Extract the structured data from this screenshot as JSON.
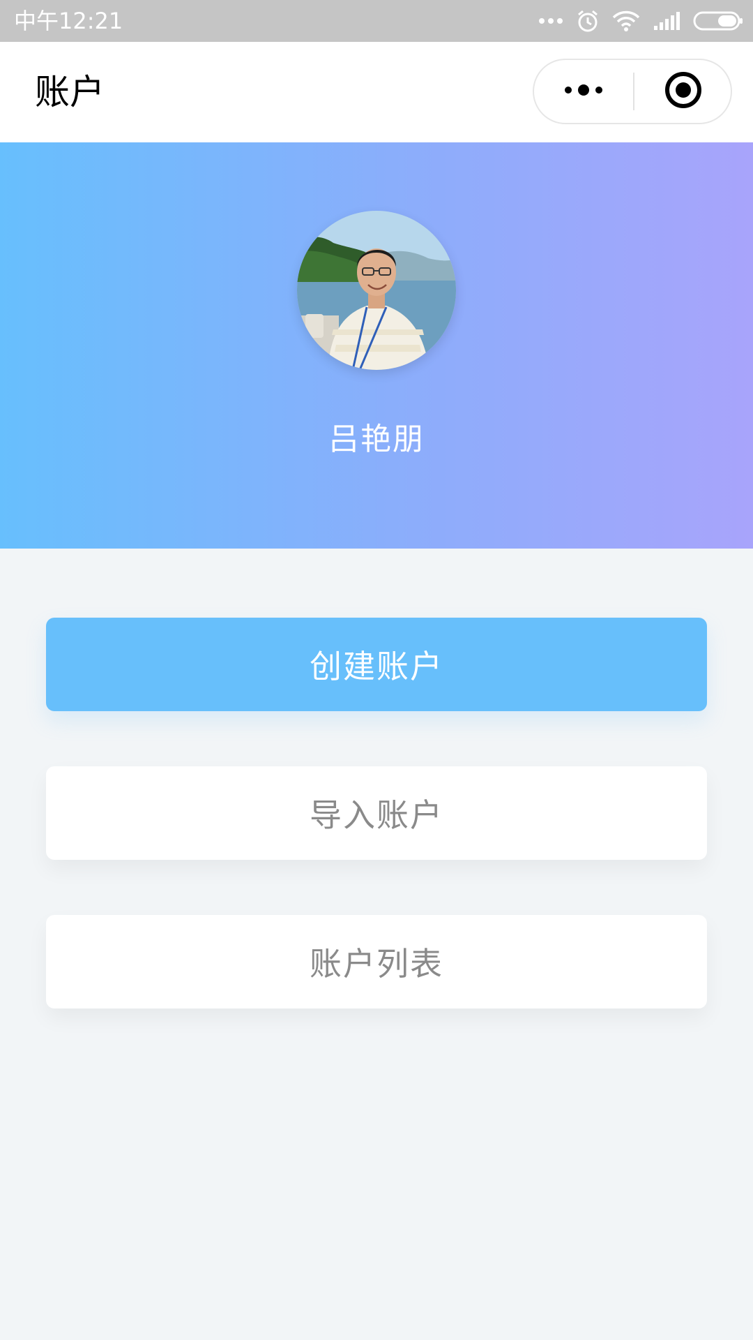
{
  "status_bar": {
    "time": "中午12:21",
    "icons": [
      "more-dots-icon",
      "alarm-icon",
      "wifi-icon",
      "signal-icon",
      "battery-icon"
    ]
  },
  "nav": {
    "title": "账户",
    "capsule_icons": [
      "more-icon",
      "close-miniprogram-icon"
    ]
  },
  "profile": {
    "name": "吕艳朋",
    "avatar_icon": "avatar-photo",
    "gradient_colors": [
      "#67bffd",
      "#8cadfb",
      "#a8a4fb"
    ]
  },
  "actions": {
    "create_label": "创建账户",
    "import_label": "导入账户",
    "list_label": "账户列表"
  },
  "colors": {
    "primary": "#67bffb",
    "background": "#f2f5f7",
    "secondary_text": "#8a8a8a"
  }
}
